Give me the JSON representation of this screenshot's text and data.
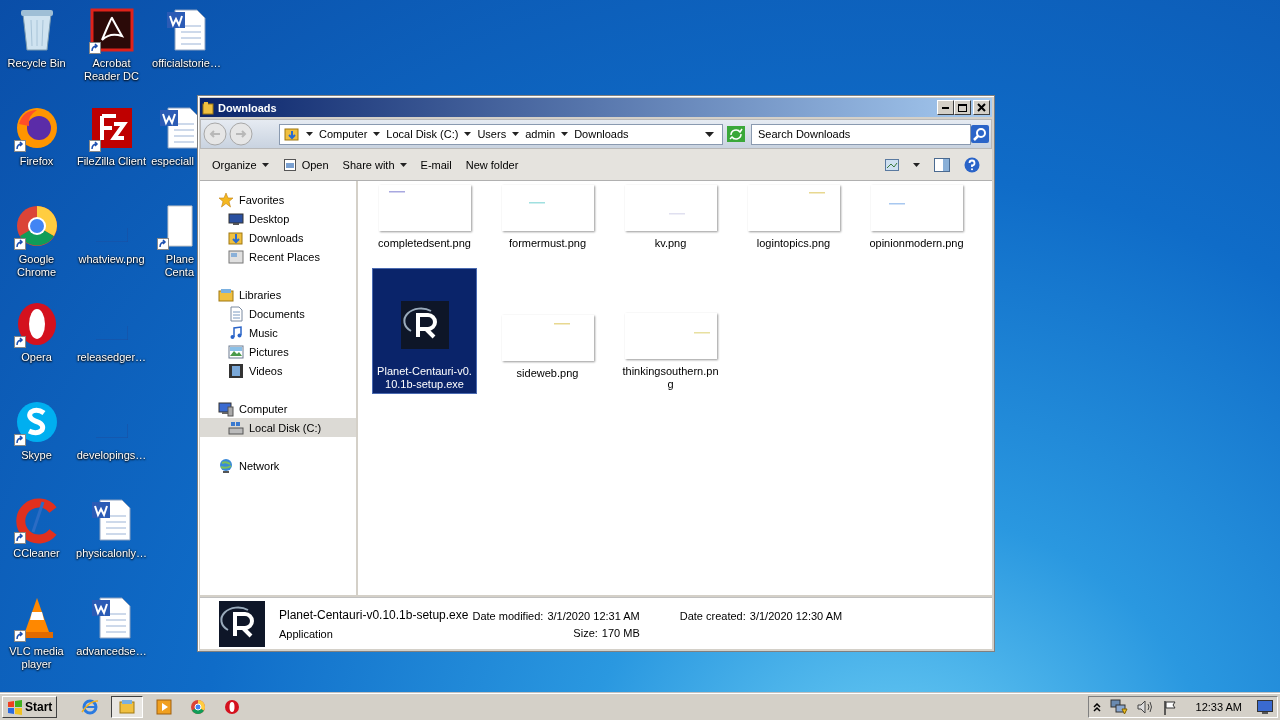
{
  "desktop_icons": [
    {
      "label": "Recycle Bin",
      "kind": "recycle",
      "shortcut": false,
      "clipped": false
    },
    {
      "label": "Firefox",
      "kind": "firefox",
      "shortcut": true,
      "clipped": false
    },
    {
      "label": "Google Chrome",
      "kind": "chrome",
      "shortcut": true,
      "clipped": false
    },
    {
      "label": "Opera",
      "kind": "opera",
      "shortcut": true,
      "clipped": false
    },
    {
      "label": "Skype",
      "kind": "skype",
      "shortcut": true,
      "clipped": false
    },
    {
      "label": "CCleaner",
      "kind": "ccleaner",
      "shortcut": true,
      "clipped": false
    },
    {
      "label": "VLC media player",
      "kind": "vlc",
      "shortcut": true,
      "clipped": false
    },
    {
      "label": "Acrobat Reader DC",
      "kind": "acrobat",
      "shortcut": true,
      "clipped": false
    },
    {
      "label": "FileZilla Client",
      "kind": "filezilla",
      "shortcut": true,
      "clipped": false
    },
    {
      "label": "whatview.png",
      "kind": "image",
      "shortcut": false,
      "clipped": false
    },
    {
      "label": "releasedger…",
      "kind": "image",
      "shortcut": false,
      "clipped": false
    },
    {
      "label": "developings…",
      "kind": "image",
      "shortcut": false,
      "clipped": false
    },
    {
      "label": "physicalonly…",
      "kind": "word",
      "shortcut": false,
      "clipped": false
    },
    {
      "label": "advancedse…",
      "kind": "word",
      "shortcut": false,
      "clipped": false
    },
    {
      "label": "officialstorie…",
      "kind": "word",
      "shortcut": false,
      "clipped": false
    },
    {
      "label": "especiall",
      "kind": "word",
      "shortcut": false,
      "clipped": true
    },
    {
      "label": "Plane Centa",
      "kind": "blank",
      "shortcut": true,
      "clipped": true
    }
  ],
  "window": {
    "title": "Downloads",
    "breadcrumbs": [
      "Computer",
      "Local Disk (C:)",
      "Users",
      "admin",
      "Downloads"
    ],
    "search": {
      "placeholder": "Search Downloads"
    },
    "toolbar": [
      {
        "label": "Organize",
        "kind": "menu"
      },
      {
        "label": "Open",
        "kind": "open"
      },
      {
        "label": "Share with",
        "kind": "menu"
      },
      {
        "label": "E-mail",
        "kind": "plain"
      },
      {
        "label": "New folder",
        "kind": "plain"
      }
    ],
    "nav": [
      {
        "label": "Favorites",
        "kind": "star",
        "selected": false,
        "children": [
          {
            "label": "Desktop",
            "kind": "desktop",
            "selected": false
          },
          {
            "label": "Downloads",
            "kind": "downloads",
            "selected": false
          },
          {
            "label": "Recent Places",
            "kind": "recent",
            "selected": false
          }
        ]
      },
      {
        "label": "Libraries",
        "kind": "libraries",
        "selected": false,
        "children": [
          {
            "label": "Documents",
            "kind": "documents",
            "selected": false
          },
          {
            "label": "Music",
            "kind": "music",
            "selected": false
          },
          {
            "label": "Pictures",
            "kind": "pictures",
            "selected": false
          },
          {
            "label": "Videos",
            "kind": "videos",
            "selected": false
          }
        ]
      },
      {
        "label": "Computer",
        "kind": "computer",
        "selected": false,
        "children": [
          {
            "label": "Local Disk (C:)",
            "kind": "disk",
            "selected": true
          }
        ]
      },
      {
        "label": "Network",
        "kind": "network",
        "selected": false
      }
    ],
    "files": [
      {
        "name": "completedsent.png",
        "kind": "image",
        "selected": false
      },
      {
        "name": "formermust.png",
        "kind": "image",
        "selected": false
      },
      {
        "name": "kv.png",
        "kind": "image",
        "selected": false
      },
      {
        "name": "logintopics.png",
        "kind": "image",
        "selected": false
      },
      {
        "name": "opinionmodern.png",
        "kind": "image",
        "selected": false
      },
      {
        "name": "Planet-Centauri-v0.10.1b-setup.exe",
        "kind": "app",
        "selected": true
      },
      {
        "name": "sideweb.png",
        "kind": "image",
        "selected": false
      },
      {
        "name": "thinkingsouthern.png",
        "kind": "image",
        "selected": false
      }
    ],
    "details": {
      "name": "Planet-Centauri-v0.10.1b-setup.exe",
      "type": "Application",
      "fields": [
        {
          "label": "Date modified:",
          "value": "3/1/2020 12:31 AM"
        },
        {
          "label": "Size:",
          "value": "170 MB"
        },
        {
          "label": "Date created:",
          "value": "3/1/2020 12:30 AM"
        }
      ]
    }
  },
  "taskbar": {
    "start": "Start",
    "apps": [
      {
        "kind": "ie",
        "selected": false
      },
      {
        "kind": "explorer",
        "selected": true
      },
      {
        "kind": "media",
        "selected": false
      },
      {
        "kind": "chrome",
        "selected": false
      },
      {
        "kind": "opera",
        "selected": false
      }
    ],
    "time": "12:33 AM"
  }
}
